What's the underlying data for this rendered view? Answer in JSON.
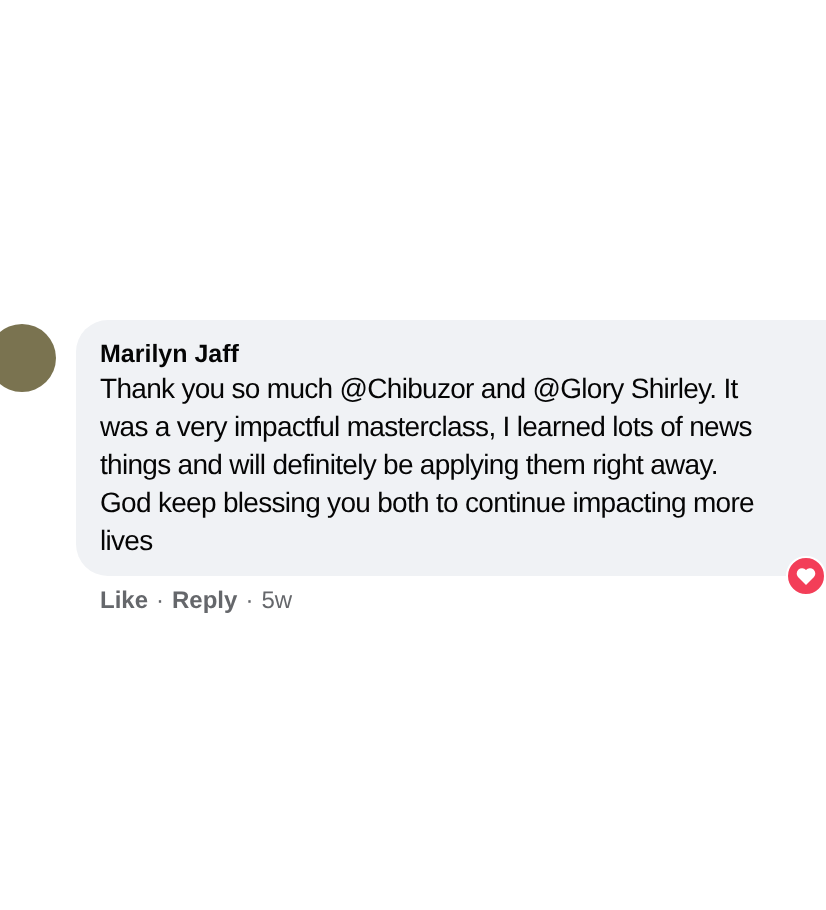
{
  "comment": {
    "author": "Marilyn Jaff",
    "text": "Thank you so much @Chibuzor and @Glory Shirley. It\nwas a very impactful masterclass, I learned lots of news\nthings and will definitely be applying them right away.\nGod keep blessing you both to continue impacting more\nlives",
    "actions": [
      {
        "label": "Like"
      },
      {
        "label": "Reply"
      }
    ],
    "separator": "·",
    "time": "5w"
  }
}
